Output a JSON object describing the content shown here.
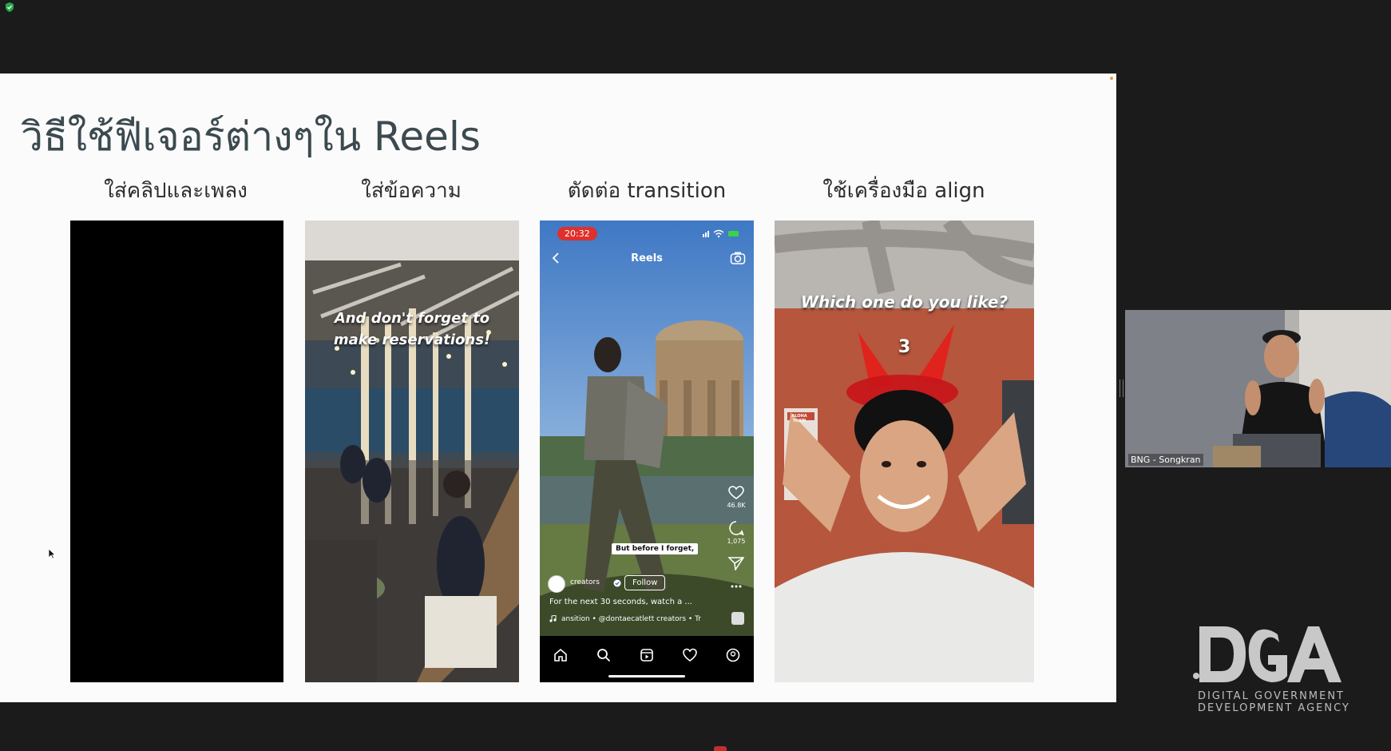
{
  "slide": {
    "title": "วิธีใช้ฟีเจอร์ต่างๆใน Reels",
    "columns": [
      {
        "label": "ใส่คลิปและเพลง"
      },
      {
        "label": "ใส่ข้อความ"
      },
      {
        "label": "ตัดต่อ transition"
      },
      {
        "label": "ใช้เครื่องมือ align"
      }
    ],
    "panel2_overlay": [
      "And don't forget to",
      "make reservations!"
    ],
    "panel3": {
      "time": "20:32",
      "header_title": "Reels",
      "likes": "46.8K",
      "comments": "1,075",
      "caption": "But before I forget,",
      "creator": "creators",
      "follow_label": "Follow",
      "description": "For the next 30 seconds, watch a ...",
      "audio": "ansition • @dontaecatlett   creators • Tr"
    },
    "panel4": {
      "question": "Which one do you like?",
      "countdown": "3",
      "poster": "ALOHA TAWN"
    }
  },
  "webcam": {
    "participant_name": "BNG - Songkran"
  },
  "logo": {
    "mark": "DGA",
    "line1": "DIGITAL GOVERNMENT",
    "line2": "DEVELOPMENT AGENCY"
  },
  "icons": {
    "shield": "shield-icon",
    "back": "chevron-left-icon",
    "camera": "camera-icon",
    "like": "heart-icon",
    "comment": "comment-icon",
    "share": "send-icon",
    "more": "more-dots-icon",
    "nav": [
      "home-icon",
      "search-icon",
      "reels-icon",
      "heart-icon",
      "profile-icon"
    ]
  },
  "colors": {
    "slide_bg": "#fbfbfc",
    "title": "#3c4a4f",
    "time_pill": "#e0302c",
    "app_bg": "#1b1b1b"
  }
}
